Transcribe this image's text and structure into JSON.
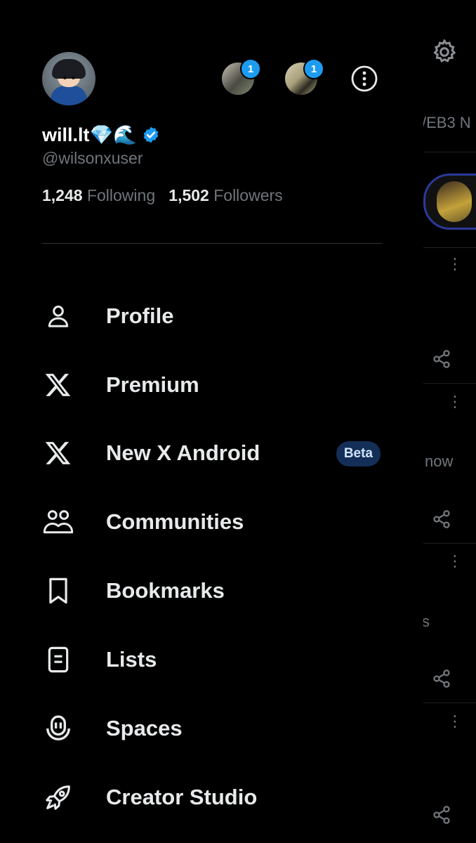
{
  "profile": {
    "display_name": "will.lt💎🌊",
    "handle": "@wilsonxuser",
    "following_count": "1,248",
    "following_label": "Following",
    "followers_count": "1,502",
    "followers_label": "Followers"
  },
  "accounts": [
    {
      "badge": "1"
    },
    {
      "badge": "1"
    }
  ],
  "menu": {
    "items": [
      {
        "label": "Profile",
        "icon": "person-icon"
      },
      {
        "label": "Premium",
        "icon": "x-logo-icon"
      },
      {
        "label": "New X Android",
        "icon": "x-logo-icon",
        "badge": "Beta"
      },
      {
        "label": "Communities",
        "icon": "communities-icon"
      },
      {
        "label": "Bookmarks",
        "icon": "bookmark-icon"
      },
      {
        "label": "Lists",
        "icon": "list-icon"
      },
      {
        "label": "Spaces",
        "icon": "spaces-icon"
      },
      {
        "label": "Creator Studio",
        "icon": "rocket-icon"
      }
    ]
  },
  "background": {
    "tab_fragment": "/EB3 N",
    "time_fragment": "now",
    "text_fragment": "s"
  },
  "colors": {
    "accent": "#1d9bf0",
    "beta_bg": "#142f57",
    "muted_text": "#71767b"
  }
}
